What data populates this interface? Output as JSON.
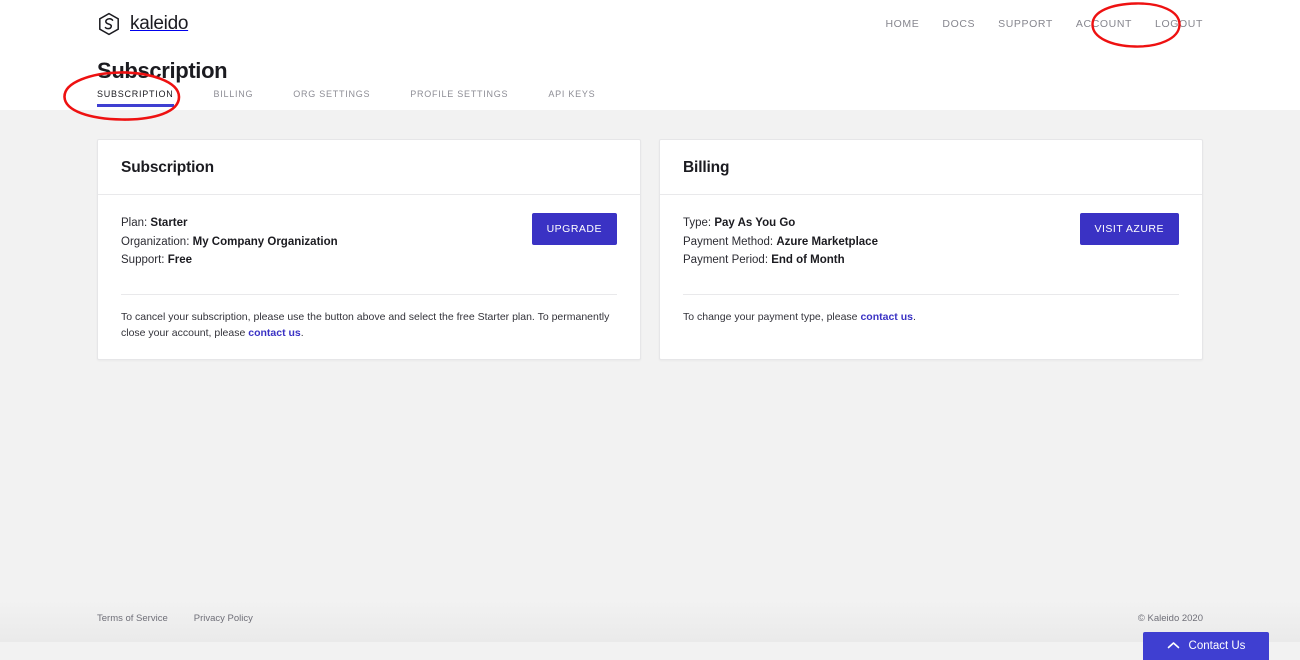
{
  "brand": {
    "name": "kaleido",
    "logo_icon": "kaleido-hex-logo-icon"
  },
  "top_nav": {
    "items": [
      {
        "label": "HOME"
      },
      {
        "label": "DOCS"
      },
      {
        "label": "SUPPORT"
      },
      {
        "label": "ACCOUNT"
      },
      {
        "label": "LOGOUT"
      }
    ]
  },
  "page": {
    "title": "Subscription"
  },
  "tabs": {
    "items": [
      {
        "label": "SUBSCRIPTION",
        "active": true
      },
      {
        "label": "BILLING",
        "active": false
      },
      {
        "label": "ORG SETTINGS",
        "active": false
      },
      {
        "label": "PROFILE SETTINGS",
        "active": false
      },
      {
        "label": "API KEYS",
        "active": false
      }
    ]
  },
  "subscription_card": {
    "title": "Subscription",
    "facts": [
      {
        "label": "Plan:",
        "value": "Starter"
      },
      {
        "label": "Organization:",
        "value": "My Company Organization"
      },
      {
        "label": "Support:",
        "value": "Free"
      }
    ],
    "cta_label": "UPGRADE",
    "note_before": "To cancel your subscription, please use the button above and select the free Starter plan. To permanently close your account, please ",
    "note_link": "contact us",
    "note_after": "."
  },
  "billing_card": {
    "title": "Billing",
    "facts": [
      {
        "label": "Type:",
        "value": "Pay As You Go"
      },
      {
        "label": "Payment Method:",
        "value": "Azure Marketplace"
      },
      {
        "label": "Payment Period:",
        "value": "End of Month"
      }
    ],
    "cta_label": "VISIT AZURE",
    "note_before": "To change your payment type, please ",
    "note_link": "contact us",
    "note_after": "."
  },
  "footer": {
    "links": [
      {
        "label": "Terms of Service"
      },
      {
        "label": "Privacy Policy"
      }
    ],
    "copyright": "© Kaleido 2020"
  },
  "contact_widget": {
    "label": "Contact Us",
    "icon": "chevron-up-icon"
  },
  "annotations": [
    {
      "name": "account-nav-highlight",
      "target": "ACCOUNT",
      "color": "#ee1111",
      "shape": "ellipse"
    },
    {
      "name": "subscription-tab-highlight",
      "target": "SUBSCRIPTION",
      "color": "#ee1111",
      "shape": "ellipse"
    }
  ],
  "colors": {
    "accent_blue": "#3a32c4",
    "tab_underline": "#3f3fd1",
    "widget_blue": "#3f3fd1",
    "annotation_red": "#ee1111",
    "page_bg": "#f2f2f2",
    "card_bg": "#ffffff"
  }
}
